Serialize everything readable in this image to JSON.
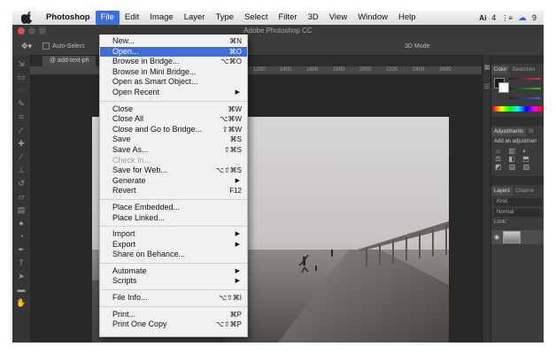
{
  "menubar": {
    "app": "Photoshop",
    "items": [
      "File",
      "Edit",
      "Image",
      "Layer",
      "Type",
      "Select",
      "Filter",
      "3D",
      "View",
      "Window",
      "Help"
    ],
    "status_1": "4",
    "status_2": "9"
  },
  "window": {
    "title": "Adobe Photoshop CC"
  },
  "options": {
    "tool_label": "Auto-Select",
    "mode_label": "3D Mode"
  },
  "document": {
    "tab": "@ add-text-ph"
  },
  "ruler": {
    "ticks": [
      "1200",
      "1400",
      "1600",
      "1800",
      "2000",
      "2200",
      "2400",
      "2600"
    ]
  },
  "file_menu": {
    "groups": [
      [
        {
          "label": "New...",
          "shortcut": "⌘N"
        },
        {
          "label": "Open...",
          "shortcut": "⌘O"
        },
        {
          "label": "Browse in Bridge...",
          "shortcut": "⌥⌘O"
        },
        {
          "label": "Browse in Mini Bridge...",
          "shortcut": ""
        },
        {
          "label": "Open as Smart Object...",
          "shortcut": ""
        },
        {
          "label": "Open Recent",
          "shortcut": "▶"
        }
      ],
      [
        {
          "label": "Close",
          "shortcut": "⌘W"
        },
        {
          "label": "Close All",
          "shortcut": "⌥⌘W"
        },
        {
          "label": "Close and Go to Bridge...",
          "shortcut": "⇧⌘W"
        },
        {
          "label": "Save",
          "shortcut": "⌘S"
        },
        {
          "label": "Save As...",
          "shortcut": "⇧⌘S"
        },
        {
          "label": "Check In...",
          "shortcut": ""
        },
        {
          "label": "Save for Web...",
          "shortcut": "⌥⇧⌘S"
        },
        {
          "label": "Generate",
          "shortcut": "▶"
        },
        {
          "label": "Revert",
          "shortcut": "F12"
        }
      ],
      [
        {
          "label": "Place Embedded...",
          "shortcut": ""
        },
        {
          "label": "Place Linked...",
          "shortcut": ""
        }
      ],
      [
        {
          "label": "Import",
          "shortcut": "▶"
        },
        {
          "label": "Export",
          "shortcut": "▶"
        },
        {
          "label": "Share on Behance...",
          "shortcut": ""
        }
      ],
      [
        {
          "label": "Automate",
          "shortcut": "▶"
        },
        {
          "label": "Scripts",
          "shortcut": "▶"
        }
      ],
      [
        {
          "label": "File Info...",
          "shortcut": "⌥⇧⌘I"
        }
      ],
      [
        {
          "label": "Print...",
          "shortcut": "⌘P"
        },
        {
          "label": "Print One Copy",
          "shortcut": "⌥⇧⌘P"
        }
      ]
    ]
  },
  "panels": {
    "color_tab": "Color",
    "swatches_tab": "Swatches",
    "adjustments_tab": "Adjustments",
    "styles_tab": "St",
    "adjustments_hint": "Add an adjustmen",
    "layers_tab": "Layers",
    "channels_tab": "Channe",
    "kind_label": "Kind",
    "blend_label": "Normal",
    "lock_label": "Lock:",
    "slider_letters": [
      "R",
      "G",
      "B"
    ]
  },
  "colors": {
    "menu_highlight": "#3d6fd6",
    "slider_r": "#d9344b",
    "slider_g": "#2fbf4a",
    "slider_b": "#3a62d9"
  }
}
